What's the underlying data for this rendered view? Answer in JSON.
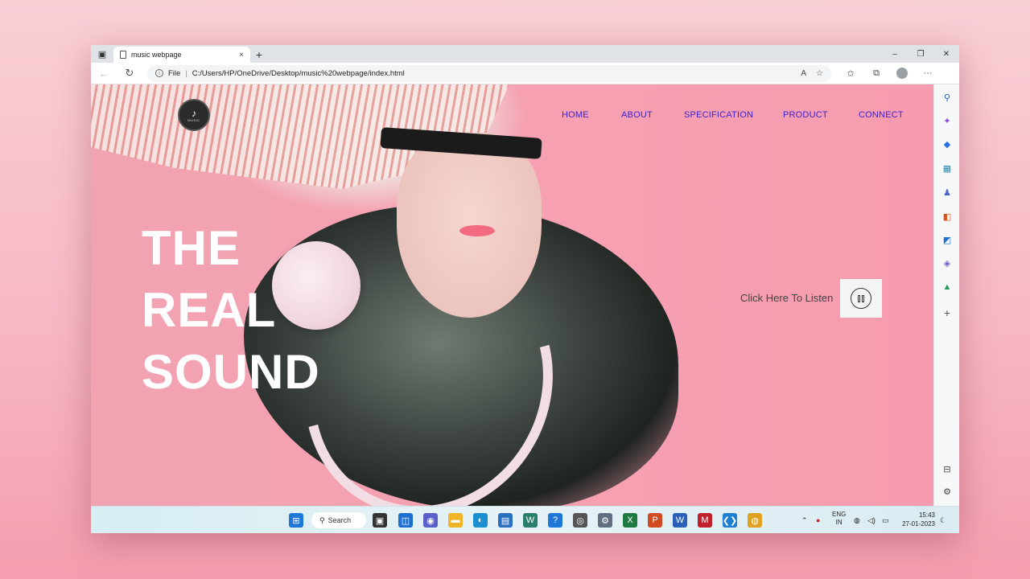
{
  "browser": {
    "tab_title": "music webpage",
    "tab_close": "×",
    "new_tab": "+",
    "window_controls": [
      "–",
      "❐",
      "✕"
    ],
    "address_prefix": "File",
    "address_separator": "|",
    "url": "C:/Users/HP/OneDrive/Desktop/music%20webpage/index.html"
  },
  "site": {
    "logo_text": "MUSIC",
    "nav": [
      {
        "label": "HOME"
      },
      {
        "label": "ABOUT"
      },
      {
        "label": "SPECIFICATION"
      },
      {
        "label": "PRODUCT"
      },
      {
        "label": "CONNECT"
      }
    ],
    "headline": [
      "THE",
      "REAL",
      "SOUND"
    ],
    "listen_text": "Click Here To Listen",
    "colors": {
      "nav": "#3b1fd1",
      "headline": "#ffffff",
      "background": "#f7a3b3"
    }
  },
  "sidebar": {
    "icons": [
      "search-icon",
      "copilot-icon",
      "shopping-tag-icon",
      "tools-icon",
      "people-icon",
      "office-icon",
      "outlook-icon",
      "drop-icon",
      "tree-icon",
      "add-icon",
      "panel-icon",
      "settings-icon"
    ]
  },
  "taskbar": {
    "search_label": "Search",
    "lang_line1": "ENG",
    "lang_line2": "IN",
    "time": "15:43",
    "date": "27-01-2023"
  }
}
